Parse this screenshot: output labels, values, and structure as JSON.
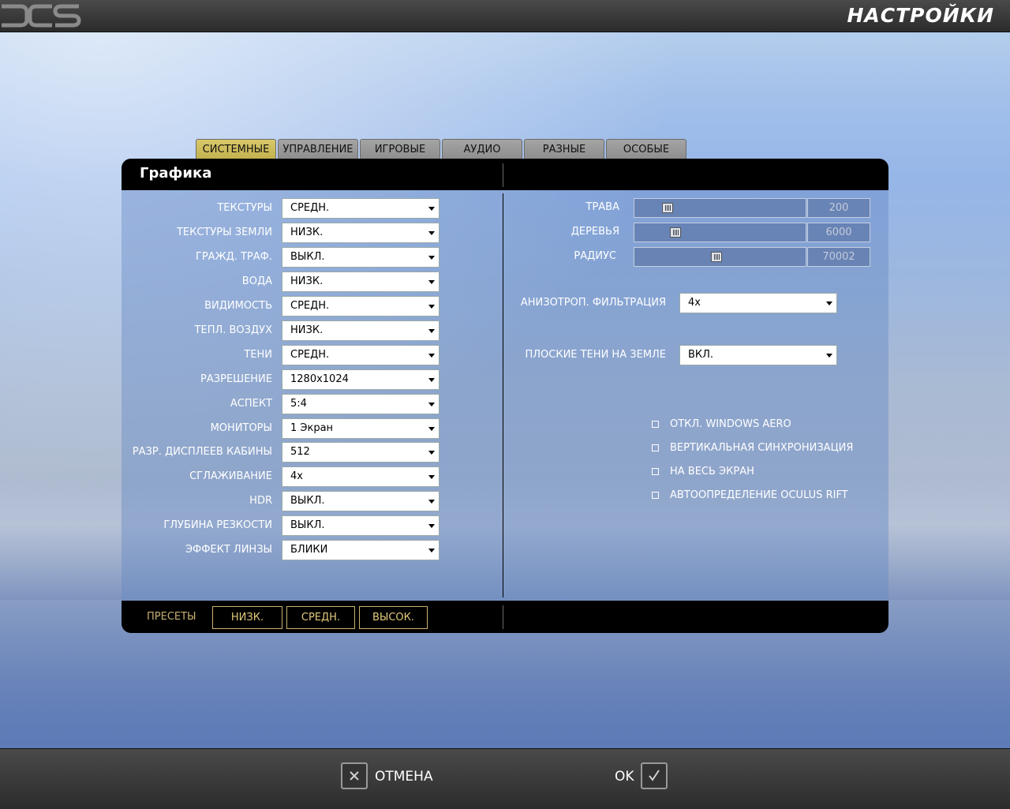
{
  "app": {
    "title": "НАСТРОЙКИ",
    "logo_text": "DCS"
  },
  "tabs": [
    {
      "label": "СИСТЕМНЫЕ",
      "active": true
    },
    {
      "label": "УПРАВЛЕНИЕ",
      "active": false
    },
    {
      "label": "ИГРОВЫЕ",
      "active": false
    },
    {
      "label": "АУДИО",
      "active": false
    },
    {
      "label": "РАЗНЫЕ",
      "active": false
    },
    {
      "label": "ОСОБЫЕ",
      "active": false
    }
  ],
  "panel": {
    "title": "Графика"
  },
  "settings": [
    {
      "label": "ТЕКСТУРЫ",
      "value": "СРЕДН."
    },
    {
      "label": "ТЕКСТУРЫ ЗЕМЛИ",
      "value": "НИЗК."
    },
    {
      "label": "ГРАЖД. ТРАФ.",
      "value": "ВЫКЛ."
    },
    {
      "label": "ВОДА",
      "value": "НИЗК."
    },
    {
      "label": "ВИДИМОСТЬ",
      "value": "СРЕДН."
    },
    {
      "label": "ТЕПЛ. ВОЗДУХ",
      "value": "НИЗК."
    },
    {
      "label": "ТЕНИ",
      "value": "СРЕДН."
    },
    {
      "label": "РАЗРЕШЕНИЕ",
      "value": "1280x1024"
    },
    {
      "label": "АСПЕКТ",
      "value": "5:4"
    },
    {
      "label": "МОНИТОРЫ",
      "value": "1 Экран"
    },
    {
      "label": "РАЗР. ДИСПЛЕЕВ КАБИНЫ",
      "value": "512"
    },
    {
      "label": "СГЛАЖИВАНИЕ",
      "value": "4x"
    },
    {
      "label": "HDR",
      "value": "ВЫКЛ."
    },
    {
      "label": "ГЛУБИНА РЕЗКОСТИ",
      "value": "ВЫКЛ."
    },
    {
      "label": "ЭФФЕКТ ЛИНЗЫ",
      "value": "БЛИКИ"
    }
  ],
  "sliders": [
    {
      "label": "ТРАВА",
      "value": "200",
      "position": 0.17
    },
    {
      "label": "ДЕРЕВЬЯ",
      "value": "6000",
      "position": 0.22
    },
    {
      "label": "РАДИУС",
      "value": "70002",
      "position": 0.48
    }
  ],
  "right_selects": {
    "anisotropic": {
      "label": "АНИЗОТРОП. ФИЛЬТРАЦИЯ",
      "value": "4x"
    },
    "flat_shadows": {
      "label": "ПЛОСКИЕ ТЕНИ НА ЗЕМЛЕ",
      "value": "ВКЛ."
    }
  },
  "checkboxes": [
    {
      "label": "ОТКЛ. WINDOWS AERO",
      "checked": false
    },
    {
      "label": "ВЕРТИКАЛЬНАЯ СИНХРОНИЗАЦИЯ",
      "checked": false
    },
    {
      "label": "НА ВЕСЬ ЭКРАН",
      "checked": false
    },
    {
      "label": "АВТООПРЕДЕЛЕНИЕ OCULUS RIFT",
      "checked": false
    }
  ],
  "presets": {
    "label": "ПРЕСЕТЫ",
    "buttons": [
      {
        "label": "НИЗК."
      },
      {
        "label": "СРЕДН."
      },
      {
        "label": "ВЫСОК."
      }
    ]
  },
  "bottom": {
    "cancel_label": "ОТМЕНА",
    "ok_label": "OK"
  },
  "colors": {
    "tab_active": "#c8b652",
    "preset_accent": "#c9b26e",
    "panel_header": "#000000"
  }
}
